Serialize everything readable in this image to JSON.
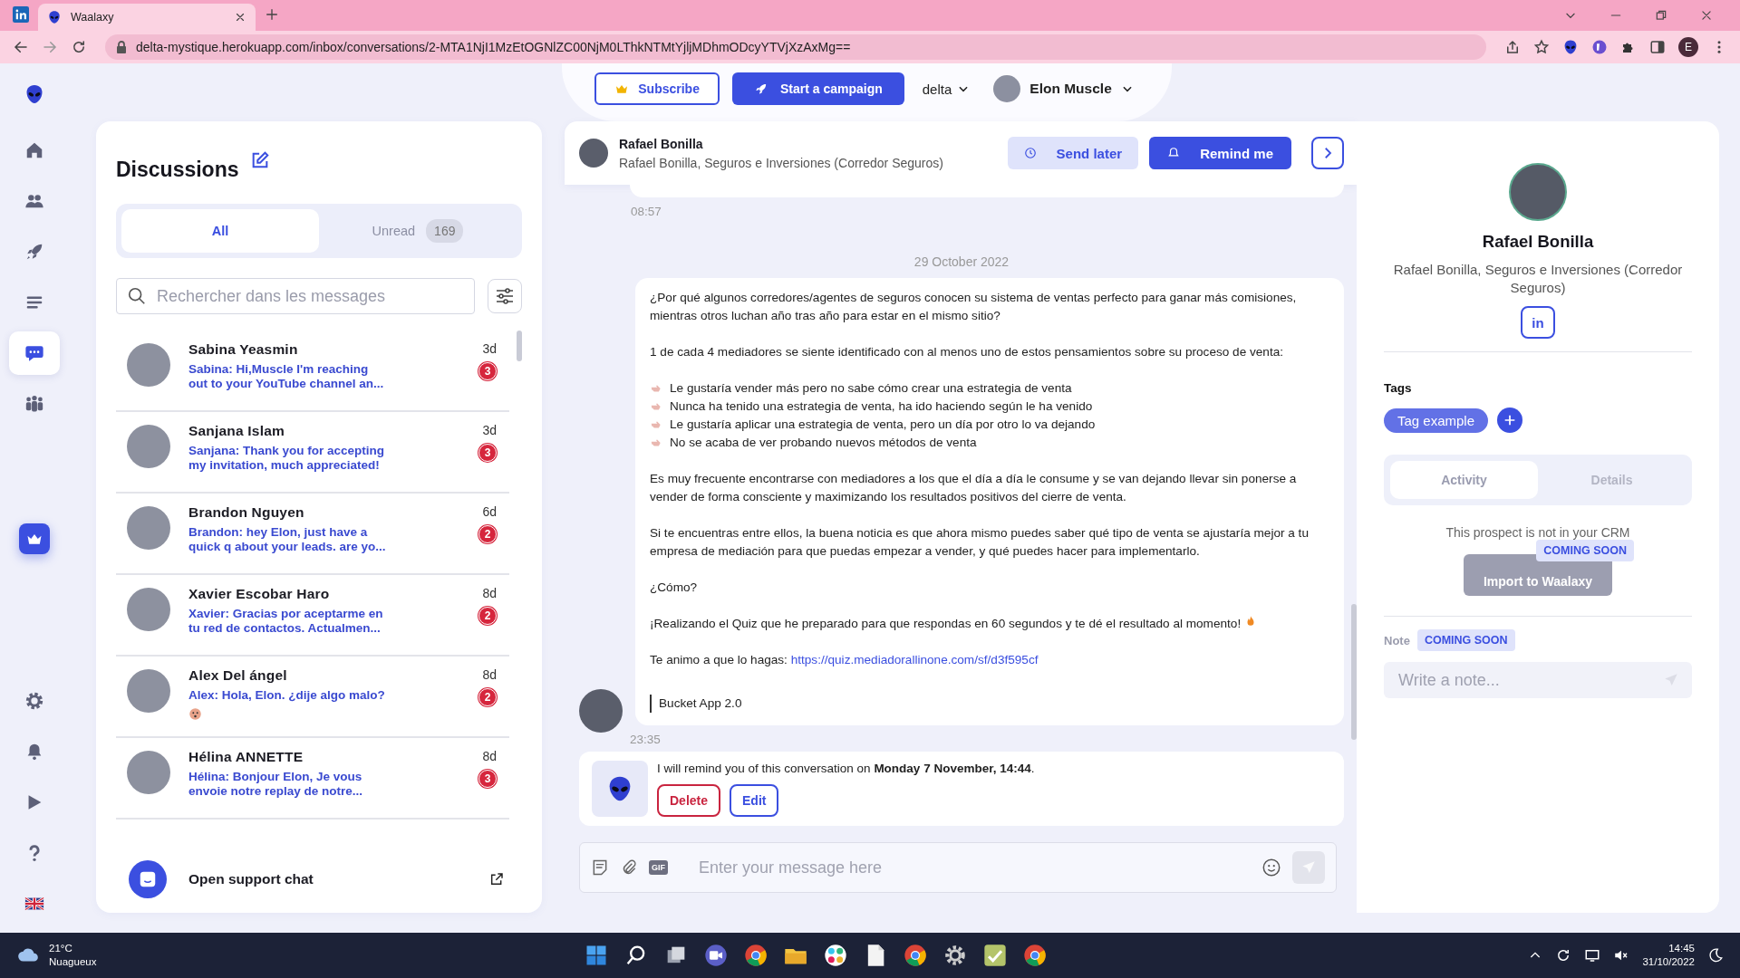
{
  "browser": {
    "tab_title": "Waalaxy",
    "url": "delta-mystique.herokuapp.com/inbox/conversations/2-MTA1NjI1MzEtOGNlZC00NjM0LThkNTMtYjljMDhmODcyYTVjXzAxMg==",
    "profile_initial": "E"
  },
  "header": {
    "subscribe": "Subscribe",
    "start_campaign": "Start a campaign",
    "workspace": "delta",
    "user": "Elon Muscle"
  },
  "rail": {
    "top": [
      {
        "kind": "home",
        "selected": false
      },
      {
        "kind": "contacts",
        "selected": false
      },
      {
        "kind": "campaigns",
        "selected": false
      },
      {
        "kind": "queue",
        "selected": false
      },
      {
        "kind": "inbox",
        "selected": true
      },
      {
        "kind": "team",
        "selected": false
      }
    ],
    "bottom": [
      {
        "kind": "settings",
        "selected": false
      },
      {
        "kind": "notifications",
        "selected": false
      },
      {
        "kind": "tutorials",
        "selected": false
      },
      {
        "kind": "help",
        "selected": false
      },
      {
        "kind": "language",
        "selected": false
      }
    ]
  },
  "discussions": {
    "title": "Discussions",
    "filters": [
      {
        "label": "All",
        "selected": true
      },
      {
        "label": "Unread",
        "count": "169",
        "selected": false
      }
    ],
    "search": {
      "placeholder": "Rechercher dans les messages"
    },
    "conversations": [
      {
        "name": "Sabina Yeasmin",
        "preview": "Sabina: Hi,Muscle I'm reaching out to your YouTube channel an...",
        "time": "3d",
        "unread": "3",
        "emoji": false
      },
      {
        "name": "Sanjana Islam",
        "preview": "Sanjana: Thank you for accepting my invitation, much appreciated!",
        "time": "3d",
        "unread": "3",
        "emoji": false
      },
      {
        "name": "Brandon Nguyen",
        "preview": "Brandon: hey Elon, just have a quick q about your leads. are yo...",
        "time": "6d",
        "unread": "2",
        "emoji": false
      },
      {
        "name": "Xavier Escobar Haro",
        "preview": "Xavier: Gracias por aceptarme en tu red de contactos. Actualmen...",
        "time": "8d",
        "unread": "2",
        "emoji": false
      },
      {
        "name": "Alex Del ángel",
        "preview": "Alex: Hola, Elon. ¿dije algo malo?",
        "time": "8d",
        "unread": "2",
        "emoji": true
      },
      {
        "name": "Hélina ANNETTE",
        "preview": "Hélina: Bonjour Elon, Je vous envoie notre replay de notre...",
        "time": "8d",
        "unread": "3",
        "emoji": false
      }
    ],
    "support": "Open support chat"
  },
  "chat": {
    "contact": "Rafael Bonilla",
    "subtitle": "Rafael Bonilla, Seguros e Inversiones (Corredor Seguros)",
    "send_later": "Send later",
    "remind_me": "Remind me",
    "earlier_time": "08:57",
    "date": "29 October 2022",
    "message": [
      {
        "kind": "text",
        "text": "¿Por qué algunos corredores/agentes de seguros conocen su sistema de ventas perfecto para ganar más comisiones, mientras otros luchan año tras año para estar en el mismo sitio?"
      },
      {
        "kind": "text",
        "text": "1 de cada 4 mediadores se siente identificado con al menos uno de estos pensamientos sobre su proceso de venta:"
      },
      {
        "kind": "bullets",
        "items": [
          "Le gustaría vender más pero no sabe cómo crear una estrategia de venta",
          "Nunca ha tenido una estrategia de venta, ha ido haciendo según le ha venido",
          "Le gustaría aplicar una estrategia de venta, pero un día por otro lo va dejando",
          "No se acaba de ver probando nuevos métodos de venta"
        ]
      },
      {
        "kind": "text",
        "text": "Es muy frecuente encontrarse con mediadores a los que el día a día le consume y se van dejando llevar sin ponerse a vender de forma consciente y maximizando los resultados positivos del cierre de venta."
      },
      {
        "kind": "text",
        "text": "Si te encuentras entre ellos, la buena noticia es que ahora mismo puedes saber qué tipo de venta se ajustaría mejor a tu empresa de mediación para que puedas empezar a vender, y qué puedes hacer para implementarlo."
      },
      {
        "kind": "text",
        "text": "¿Cómo?"
      },
      {
        "kind": "text",
        "text": "¡Realizando el Quiz que he preparado para que respondas en 60 segundos y te dé el resultado al momento!",
        "emoji": true
      },
      {
        "kind": "link",
        "text": "Te animo a que lo hagas:",
        "url": "https://quiz.mediadorallinone.com/sf/d3f595cf"
      },
      {
        "kind": "quote",
        "text": "Bucket App 2.0"
      }
    ],
    "time": "23:35",
    "reminder": {
      "text": "I will remind you of this conversation on **Monday 7 November, 14:44**.",
      "delete": "Delete",
      "edit": "Edit"
    },
    "composer": {
      "gif_label": "GIF",
      "placeholder": "Enter your message here",
      "send_disabled": true
    }
  },
  "profile": {
    "name": "Rafael Bonilla",
    "subtitle": "Rafael Bonilla, Seguros e Inversiones (Corredor Seguros)",
    "linkedin": "in",
    "tags_label": "Tags",
    "tags": [
      "Tag example"
    ],
    "tabs": [
      {
        "label": "Activity",
        "selected": true
      },
      {
        "label": "Details",
        "selected": false
      }
    ],
    "crm_text": "This prospect is not in your CRM",
    "import_button": "Import to Waalaxy",
    "import_disabled": true,
    "import_badge": "COMING SOON",
    "note": {
      "label": "Note",
      "badge": "COMING SOON",
      "placeholder": "Write a note...",
      "disabled": true
    }
  },
  "taskbar": {
    "temperature": "21°C",
    "weather": "Nuagueux",
    "time": "14:45",
    "date": "31/10/2022"
  }
}
